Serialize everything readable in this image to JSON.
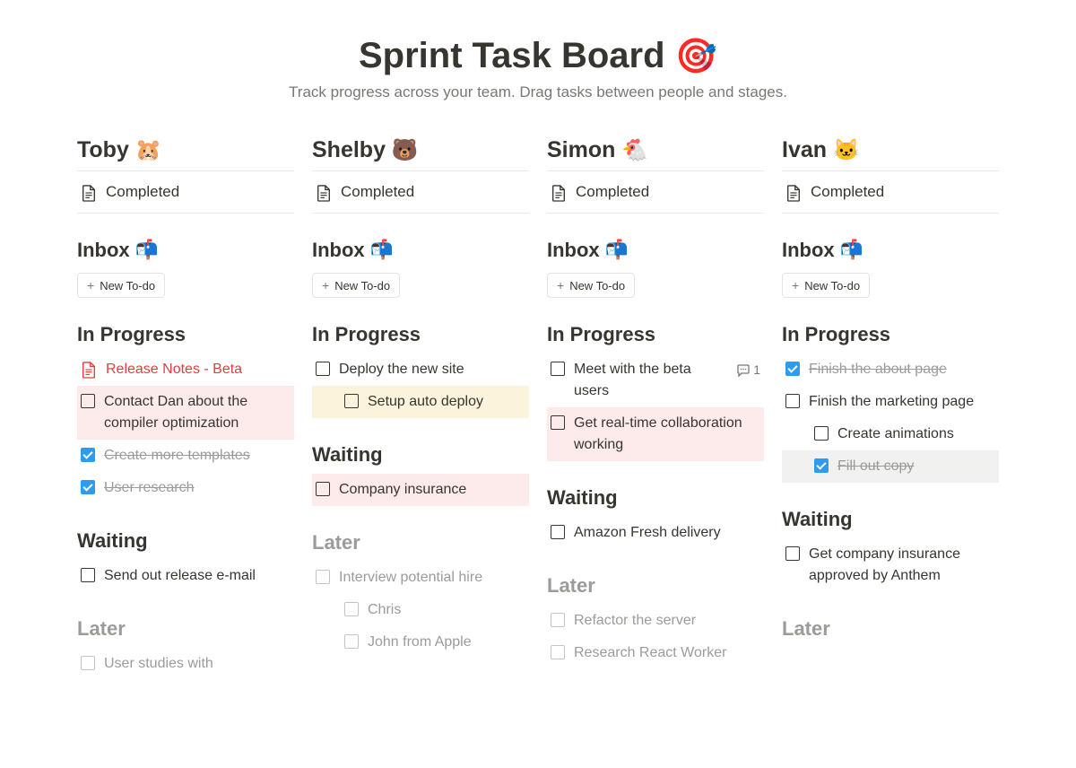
{
  "header": {
    "title": "Sprint Task Board",
    "title_emoji": "🎯",
    "subtitle": "Track progress across your team.  Drag tasks between people and stages."
  },
  "labels": {
    "completed": "Completed",
    "inbox": "Inbox",
    "inbox_emoji": "📬",
    "new_todo": "New To-do",
    "in_progress": "In Progress",
    "waiting": "Waiting",
    "later": "Later"
  },
  "columns": [
    {
      "name": "Toby",
      "emoji": "🐹",
      "in_progress": [
        {
          "text": "Release Notes - Beta",
          "type": "doc",
          "style": "red"
        },
        {
          "text": "Contact Dan about the compiler optimization",
          "bg": "pink"
        },
        {
          "text": "Create more templates",
          "checked": true,
          "done": true
        },
        {
          "text": "User research",
          "checked": true,
          "done": true
        }
      ],
      "waiting": [
        {
          "text": "Send out release e-mail"
        }
      ],
      "later": [
        {
          "text": "User studies with",
          "muted": true
        }
      ]
    },
    {
      "name": "Shelby",
      "emoji": "🐻",
      "in_progress": [
        {
          "text": "Deploy the new site"
        },
        {
          "text": "Setup auto deploy",
          "indent": 1,
          "bg": "yellow"
        }
      ],
      "waiting": [
        {
          "text": "Company insurance",
          "bg": "pink"
        }
      ],
      "later": [
        {
          "text": "Interview potential hire",
          "muted": true
        },
        {
          "text": "Chris",
          "indent": 1,
          "muted": true
        },
        {
          "text": "John from Apple",
          "indent": 1,
          "muted": true
        }
      ]
    },
    {
      "name": "Simon",
      "emoji": "🐔",
      "in_progress": [
        {
          "text": "Meet with the beta users",
          "comments": 1
        },
        {
          "text": "Get real-time collaboration working",
          "bg": "pink"
        }
      ],
      "waiting": [
        {
          "text": "Amazon Fresh delivery"
        }
      ],
      "later": [
        {
          "text": "Refactor the server",
          "muted": true
        },
        {
          "text": "Research React Worker",
          "muted": true
        }
      ]
    },
    {
      "name": "Ivan",
      "emoji": "🐱",
      "in_progress": [
        {
          "text": "Finish the about page",
          "checked": true,
          "done": true
        },
        {
          "text": "Finish the marketing page"
        },
        {
          "text": "Create animations",
          "indent": 1
        },
        {
          "text": "Fill out copy",
          "indent": 1,
          "checked": true,
          "done": true,
          "bg": "gray"
        }
      ],
      "waiting": [
        {
          "text": "Get company insurance approved by Anthem"
        }
      ],
      "later": []
    }
  ]
}
